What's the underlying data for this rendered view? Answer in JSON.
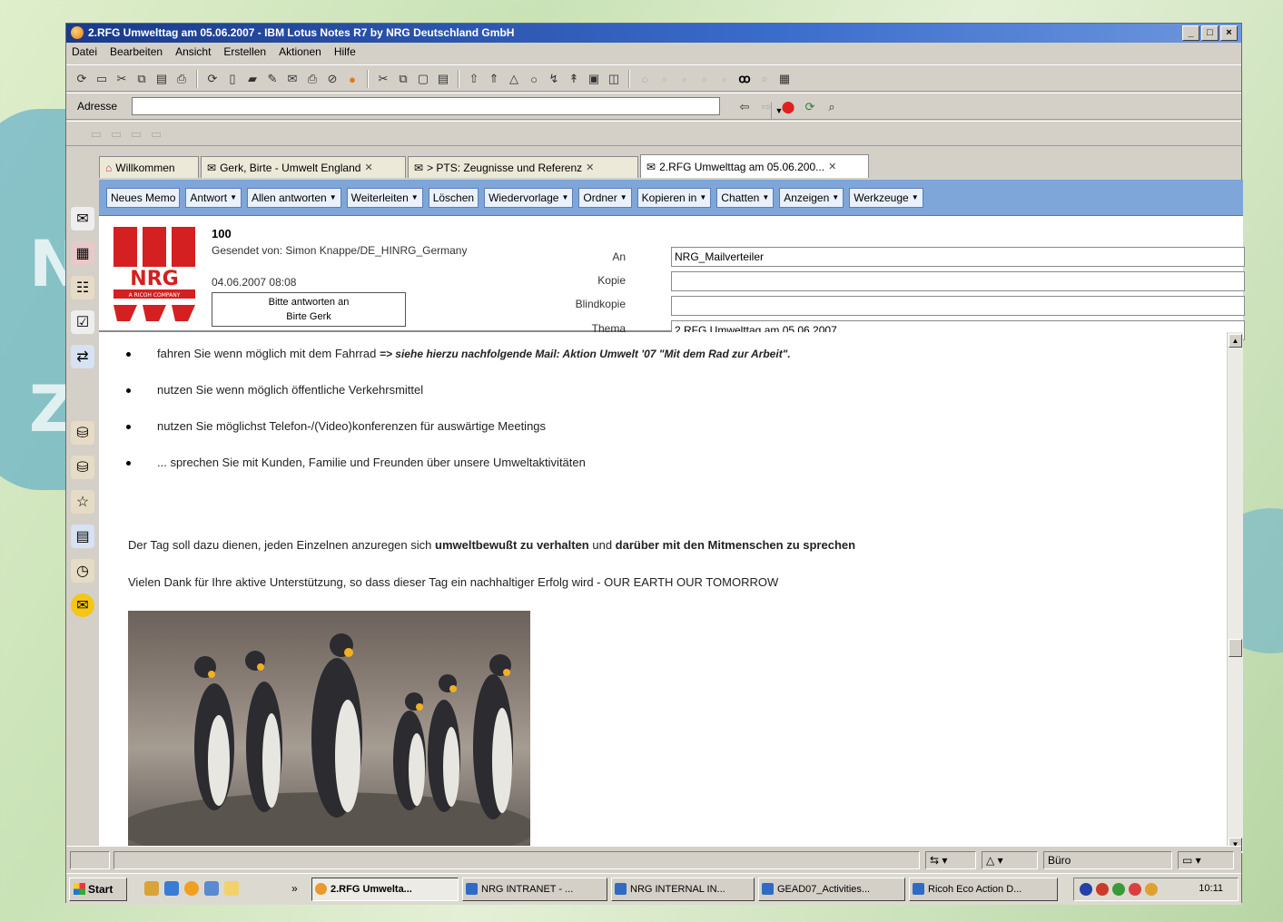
{
  "window": {
    "title": "2.RFG Umwelttag am 05.06.2007 - IBM Lotus Notes R7 by NRG Deutschland GmbH",
    "min": "_",
    "max": "□",
    "close": "×"
  },
  "menu": [
    "Datei",
    "Bearbeiten",
    "Ansicht",
    "Erstellen",
    "Aktionen",
    "Hilfe"
  ],
  "address": {
    "label": "Adresse",
    "value": ""
  },
  "tabs": [
    {
      "label": "Willkommen",
      "icon": "home-icon"
    },
    {
      "label": "Gerk, Birte - Umwelt England",
      "icon": "mail-icon"
    },
    {
      "label": "> PTS: Zeugnisse und Referenz",
      "icon": "mail-icon"
    },
    {
      "label": "2.RFG Umwelttag am 05.06.200...",
      "icon": "mail-icon"
    }
  ],
  "actions": [
    {
      "label": "Neues Memo",
      "dropdown": false
    },
    {
      "label": "Antwort",
      "dropdown": true
    },
    {
      "label": "Allen antworten",
      "dropdown": true
    },
    {
      "label": "Weiterleiten",
      "dropdown": true
    },
    {
      "label": "Löschen",
      "dropdown": false
    },
    {
      "label": "Wiedervorlage",
      "dropdown": true
    },
    {
      "label": "Ordner",
      "dropdown": true
    },
    {
      "label": "Kopieren in",
      "dropdown": true
    },
    {
      "label": "Chatten",
      "dropdown": true
    },
    {
      "label": "Anzeigen",
      "dropdown": true
    },
    {
      "label": "Werkzeuge",
      "dropdown": true
    }
  ],
  "header": {
    "logo_text": "NRG",
    "logo_sub": "A RICOH COMPANY",
    "number": "100",
    "sent_by": "Gesendet von: Simon Knappe/DE_HINRG_Germany",
    "date": "04.06.2007 08:08",
    "reply_to_line1": "Bitte antworten an",
    "reply_to_line2": "Birte Gerk",
    "labels": {
      "to": "An",
      "cc": "Kopie",
      "bcc": "Blindkopie",
      "subject": "Thema"
    },
    "to": "NRG_Mailverteiler",
    "cc": "",
    "bcc": "",
    "subject": "2.RFG Umwelttag am 05.06.2007"
  },
  "body": {
    "bullets": [
      {
        "text": "fahren Sie wenn möglich mit dem Fahrrad ",
        "emph": "=> siehe hierzu nachfolgende Mail: Aktion Umwelt '07 \"Mit dem Rad zur Arbeit\"."
      },
      {
        "text": "nutzen Sie wenn möglich öffentliche Verkehrsmittel",
        "emph": ""
      },
      {
        "text": "nutzen Sie möglichst Telefon-/(Video)konferenzen für auswärtige Meetings",
        "emph": ""
      },
      {
        "text": "... sprechen Sie mit Kunden, Familie und Freunden über unsere Umweltaktivitäten",
        "emph": ""
      }
    ],
    "para1_a": "Der Tag soll dazu dienen, jeden Einzelnen anzuregen sich ",
    "para1_b": "umweltbewußt zu verhalten",
    "para1_c": " und ",
    "para1_d": "darüber mit den Mitmenschen zu sprechen",
    "para2": "Vielen Dank für Ihre aktive Unterstützung, so dass dieser Tag ein nachhaltiger Erfolg wird - OUR EARTH OUR TOMORROW"
  },
  "status": {
    "location": "Büro"
  },
  "taskbar": {
    "start": "Start",
    "more": "»",
    "tasks": [
      {
        "label": "2.RFG Umwelta...",
        "active": true,
        "color": "#e89a2a"
      },
      {
        "label": "NRG INTRANET - ...",
        "active": false,
        "color": "#2f6bc4"
      },
      {
        "label": "NRG INTERNAL IN...",
        "active": false,
        "color": "#2f6bc4"
      },
      {
        "label": "GEAD07_Activities...",
        "active": false,
        "color": "#2f6bc4"
      },
      {
        "label": "Ricoh Eco Action D...",
        "active": false,
        "color": "#2f6bc4"
      }
    ],
    "clock": "10:11"
  },
  "colors": {
    "accent": "#7ea6d8",
    "logo_red": "#d42020",
    "title_blue": "#1a3a8a"
  }
}
